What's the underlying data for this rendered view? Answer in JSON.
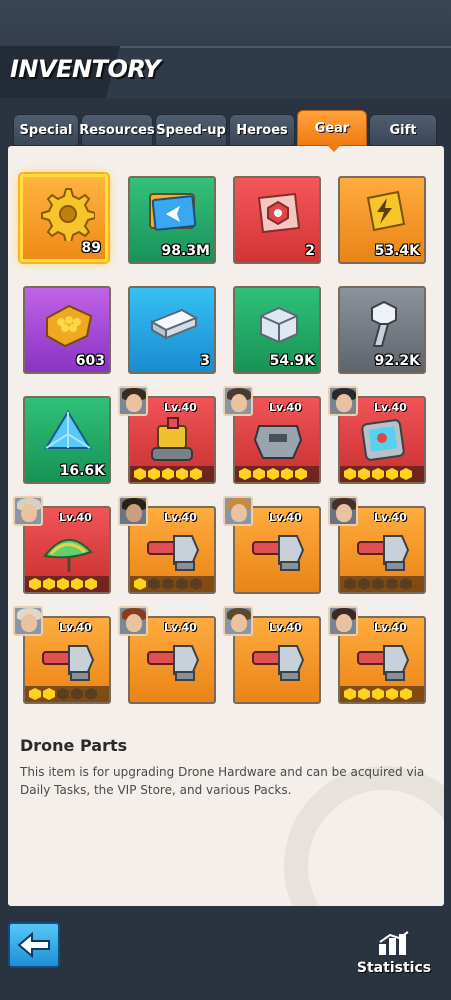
{
  "header": {
    "title": "INVENTORY"
  },
  "tabs": [
    {
      "label": "Special",
      "active": false
    },
    {
      "label": "Resources",
      "active": false
    },
    {
      "label": "Speed-up",
      "active": false
    },
    {
      "label": "Heroes",
      "active": false
    },
    {
      "label": "Gear",
      "active": true
    },
    {
      "label": "Gift",
      "active": false
    }
  ],
  "items": [
    {
      "name": "gear-cog-item",
      "count": "89",
      "selected": true
    },
    {
      "name": "blueprint-item",
      "count": "98.3M"
    },
    {
      "name": "red-chip-item",
      "count": "2"
    },
    {
      "name": "power-battery-item",
      "count": "53.4K"
    },
    {
      "name": "honeycomb-alloy-item",
      "count": "603"
    },
    {
      "name": "steel-ingot-item",
      "count": "3"
    },
    {
      "name": "titanium-block-item",
      "count": "54.9K"
    },
    {
      "name": "bolt-screw-item",
      "count": "92.2K"
    },
    {
      "name": "blue-crystal-item",
      "count": "16.6K"
    },
    {
      "name": "mech-robot-gear",
      "level": "Lv.40",
      "stars": 5
    },
    {
      "name": "armor-plate-gear",
      "level": "Lv.40",
      "stars": 5
    },
    {
      "name": "scanner-tablet-gear",
      "level": "Lv.40",
      "stars": 5
    },
    {
      "name": "rainbow-leaf-gear",
      "level": "Lv.40",
      "stars": 5
    },
    {
      "name": "turret-gear",
      "level": "Lv.40",
      "stars": 1
    },
    {
      "name": "turret-gear",
      "level": "Lv.40",
      "stars": 0
    },
    {
      "name": "turret-gear",
      "level": "Lv.40",
      "stars": 0
    },
    {
      "name": "turret-gear",
      "level": "Lv.40",
      "stars": 2
    },
    {
      "name": "turret-gear",
      "level": "Lv.40",
      "stars": 0
    },
    {
      "name": "turret-gear",
      "level": "Lv.40",
      "stars": 0
    },
    {
      "name": "turret-gear",
      "level": "Lv.40",
      "stars": 5
    }
  ],
  "description": {
    "title": "Drone Parts",
    "body": "This item is for upgrading Drone Hardware and can be acquired via Daily Tasks, the VIP Store, and various Packs."
  },
  "footer": {
    "statistics_label": "Statistics"
  },
  "colors": {
    "accent_orange": "#f07a12",
    "panel_bg": "#f4efea",
    "back_blue": "#1f8fd8"
  }
}
